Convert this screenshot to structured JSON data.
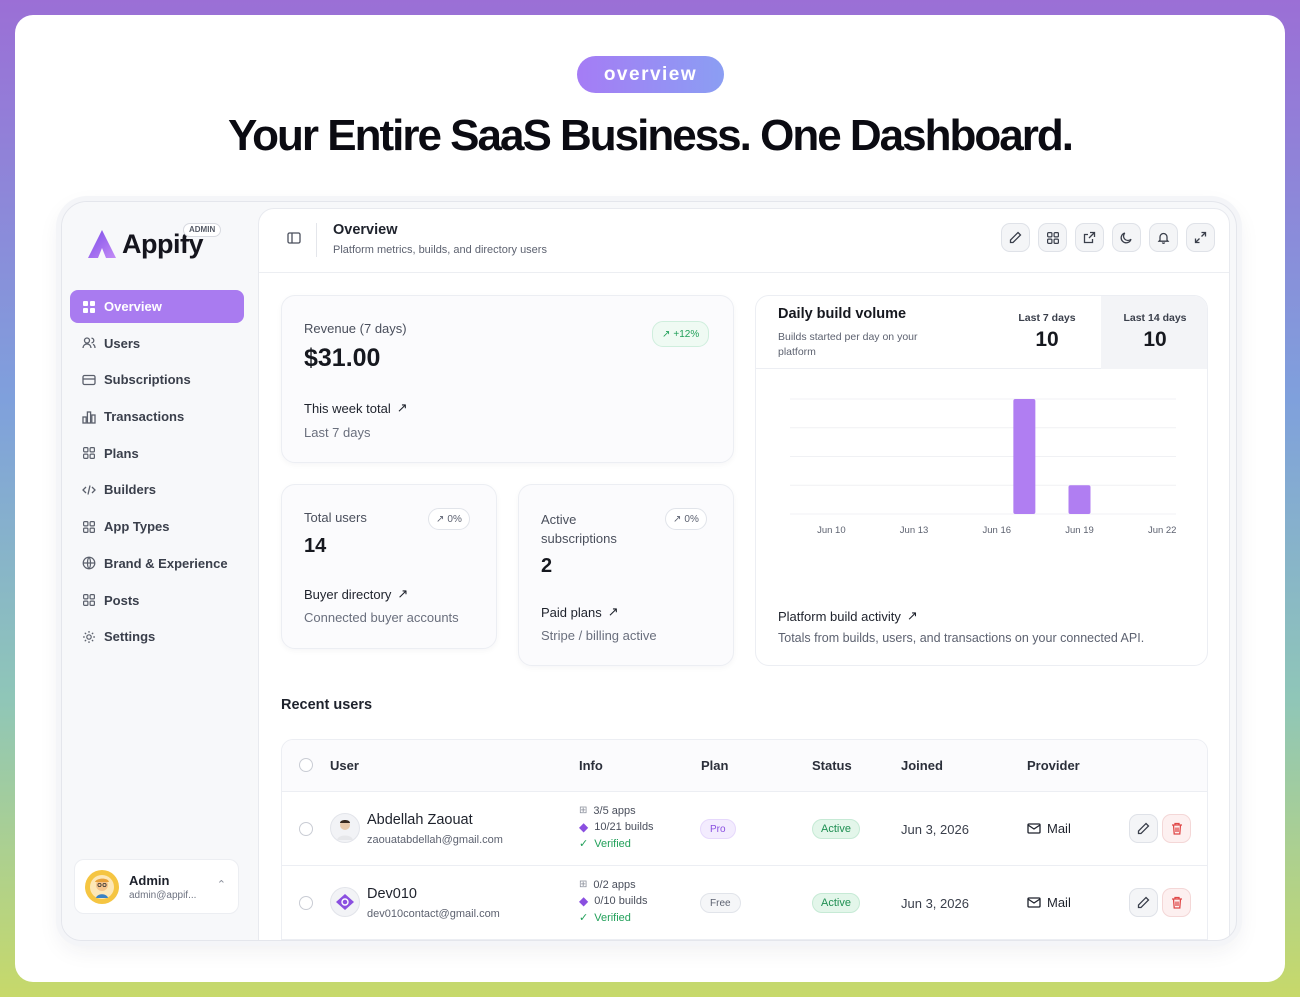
{
  "hero": {
    "pill": "overview",
    "headline": "Your Entire SaaS Business. One Dashboard."
  },
  "sidebar": {
    "logo_text": "Appify",
    "admin_tag": "ADMIN",
    "items": [
      {
        "label": "Overview",
        "icon": "grid-icon",
        "active": true
      },
      {
        "label": "Users",
        "icon": "users-icon"
      },
      {
        "label": "Subscriptions",
        "icon": "card-icon"
      },
      {
        "label": "Transactions",
        "icon": "bar-chart-icon"
      },
      {
        "label": "Plans",
        "icon": "grid-icon"
      },
      {
        "label": "Builders",
        "icon": "code-icon"
      },
      {
        "label": "App Types",
        "icon": "grid-icon"
      },
      {
        "label": "Brand & Experience",
        "icon": "globe-icon"
      },
      {
        "label": "Posts",
        "icon": "grid-icon"
      },
      {
        "label": "Settings",
        "icon": "gear-icon"
      }
    ],
    "user": {
      "name": "Admin",
      "email": "admin@appif..."
    }
  },
  "topbar": {
    "title": "Overview",
    "subtitle": "Platform metrics, builds, and directory users",
    "tools": [
      "pencil-icon",
      "grid-icon",
      "external-link-icon",
      "moon-icon",
      "bell-icon",
      "expand-icon"
    ]
  },
  "revenue": {
    "label": "Revenue (7 days)",
    "value": "$31.00",
    "badge": "+12%",
    "foot": "This week total",
    "foot2": "Last 7 days"
  },
  "total_users": {
    "label": "Total users",
    "value": "14",
    "badge": "0%",
    "foot": "Buyer directory",
    "foot2": "Connected buyer accounts"
  },
  "active_subs": {
    "label": "Active subscriptions",
    "value": "2",
    "badge": "0%",
    "foot": "Paid plans",
    "foot2": "Stripe / billing active"
  },
  "build_card": {
    "title": "Daily build volume",
    "subtitle": "Builds started per day on your platform",
    "tabs": [
      {
        "label": "Last 7 days",
        "value": "10"
      },
      {
        "label": "Last 14 days",
        "value": "10",
        "selected": true
      }
    ],
    "foot": "Platform build activity",
    "foot2": "Totals from builds, users, and transactions on your connected API."
  },
  "chart_data": {
    "type": "bar",
    "x_tick_labels": [
      "Jun 10",
      "Jun 13",
      "Jun 16",
      "Jun 19",
      "Jun 22"
    ],
    "categories": [
      "Jun 9",
      "Jun 10",
      "Jun 11",
      "Jun 12",
      "Jun 13",
      "Jun 14",
      "Jun 15",
      "Jun 16",
      "Jun 17",
      "Jun 18",
      "Jun 19",
      "Jun 20",
      "Jun 21",
      "Jun 22"
    ],
    "values": [
      0,
      0,
      0,
      0,
      0,
      0,
      0,
      0,
      8,
      0,
      2,
      0,
      0,
      0
    ],
    "ylim": [
      0,
      8
    ],
    "grid": true,
    "bar_color": "#b07ef2"
  },
  "recent": {
    "title": "Recent users",
    "columns": [
      "User",
      "Info",
      "Plan",
      "Status",
      "Joined",
      "Provider"
    ],
    "rows": [
      {
        "name": "Abdellah Zaouat",
        "email": "zaouatabdellah@gmail.com",
        "apps": "3/5 apps",
        "builds": "10/21 builds",
        "verified": "Verified",
        "plan": "Pro",
        "status": "Active",
        "joined": "Jun 3, 2026",
        "provider": "Mail"
      },
      {
        "name": "Dev010",
        "email": "dev010contact@gmail.com",
        "apps": "0/2 apps",
        "builds": "0/10 builds",
        "verified": "Verified",
        "plan": "Free",
        "status": "Active",
        "joined": "Jun 3, 2026",
        "provider": "Mail"
      }
    ]
  }
}
